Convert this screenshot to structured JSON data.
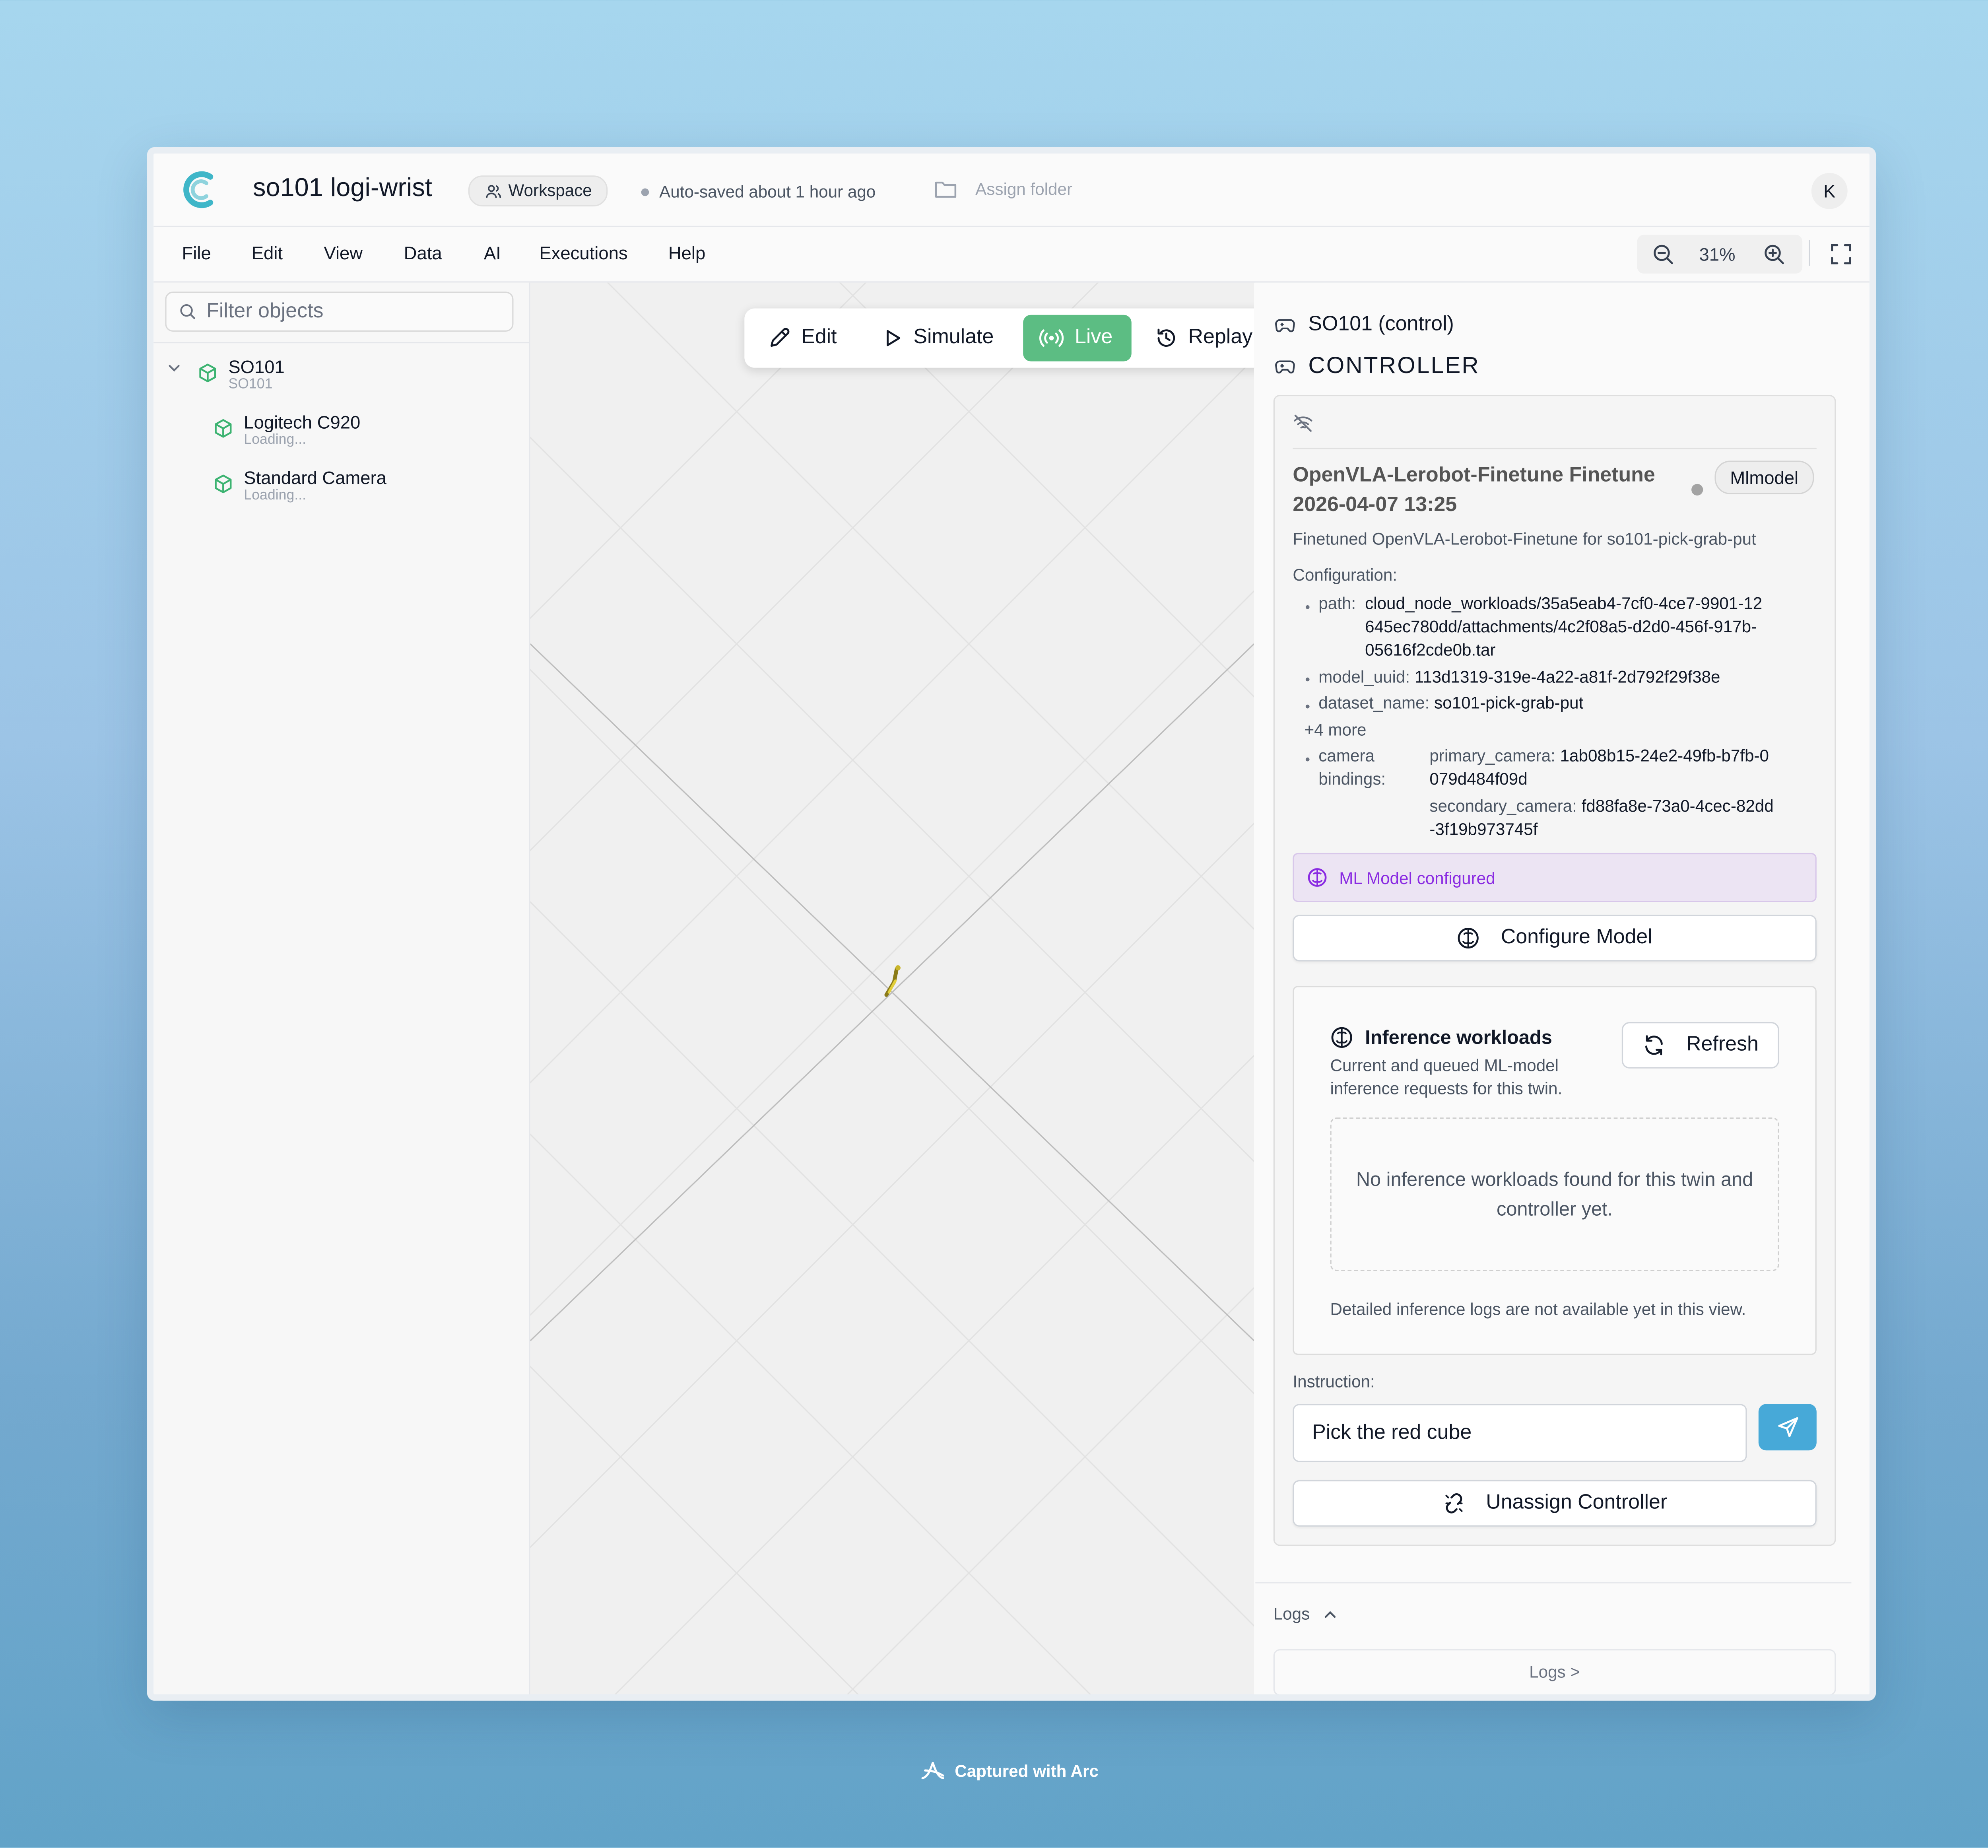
{
  "header": {
    "title": "so101 logi-wrist",
    "workspace_label": "Workspace",
    "autosave_text": "Auto-saved about 1 hour ago",
    "assign_folder_label": "Assign folder",
    "avatar_initial": "K"
  },
  "menu": {
    "file": "File",
    "edit": "Edit",
    "view": "View",
    "data": "Data",
    "ai": "AI",
    "executions": "Executions",
    "help": "Help"
  },
  "zoom": {
    "level": "31%"
  },
  "sidebar": {
    "filter_placeholder": "Filter objects",
    "tree": {
      "root": {
        "name": "SO101",
        "sub": "SO101"
      },
      "children": [
        {
          "name": "Logitech C920",
          "sub": "Loading..."
        },
        {
          "name": "Standard Camera",
          "sub": "Loading..."
        }
      ]
    }
  },
  "modes": {
    "edit": "Edit",
    "simulate": "Simulate",
    "live": "Live",
    "replay": "Replay",
    "active": "Live"
  },
  "panel": {
    "control_title": "SO101 (control)",
    "controller_heading": "CONTROLLER",
    "model_title": "OpenVLA-Lerobot-Finetune Finetune 2026-04-07 13:25",
    "model_badge": "Mlmodel",
    "description": "Finetuned OpenVLA-Lerobot-Finetune for so101-pick-grab-put",
    "config_label": "Configuration:",
    "config": {
      "path_key": "path:",
      "path_value_lines": [
        "cloud_node_workloads/35a5eab4-7cf0-4ce7-9901-12",
        "645ec780dd/attachments/4c2f08a5-d2d0-456f-917b-",
        "05616f2cde0b.tar"
      ],
      "model_uuid_key": "model_uuid:",
      "model_uuid_value": "113d1319-319e-4a22-a81f-2d792f29f38e",
      "dataset_name_key": "dataset_name:",
      "dataset_name_value": "so101-pick-grab-put",
      "more": "+4 more",
      "camera_key_lines": [
        "camera",
        "bindings:"
      ],
      "primary_camera_key": "primary_camera:",
      "primary_camera_value_lines": [
        "1ab08b15-24e2-49fb-b7fb-0",
        "079d484f09d"
      ],
      "secondary_camera_key": "secondary_camera:",
      "secondary_camera_value_lines": [
        "fd88fa8e-73a0-4cec-82dd",
        "-3f19b973745f"
      ]
    },
    "ml_banner": "ML Model configured",
    "configure_button": "Configure Model",
    "inference": {
      "title": "Inference workloads",
      "subtitle_lines": [
        "Current and queued ML-model",
        "inference requests for this twin."
      ],
      "refresh_label": "Refresh",
      "empty_text": "No inference workloads found for this twin and controller yet.",
      "footnote": "Detailed inference logs are not available yet in this view."
    },
    "instruction_label": "Instruction:",
    "instruction_value": "Pick the red cube",
    "unassign_button": "Unassign Controller",
    "logs_toggle": "Logs",
    "logs_button": "Logs >"
  },
  "footer": {
    "caption": "Captured with Arc"
  },
  "colors": {
    "brand_teal": "#3fb6c8",
    "live_green": "#5cbd83",
    "send_blue": "#47a9d8",
    "ml_purple": "#8a2be2",
    "tree_icon_green": "#3cb371"
  }
}
